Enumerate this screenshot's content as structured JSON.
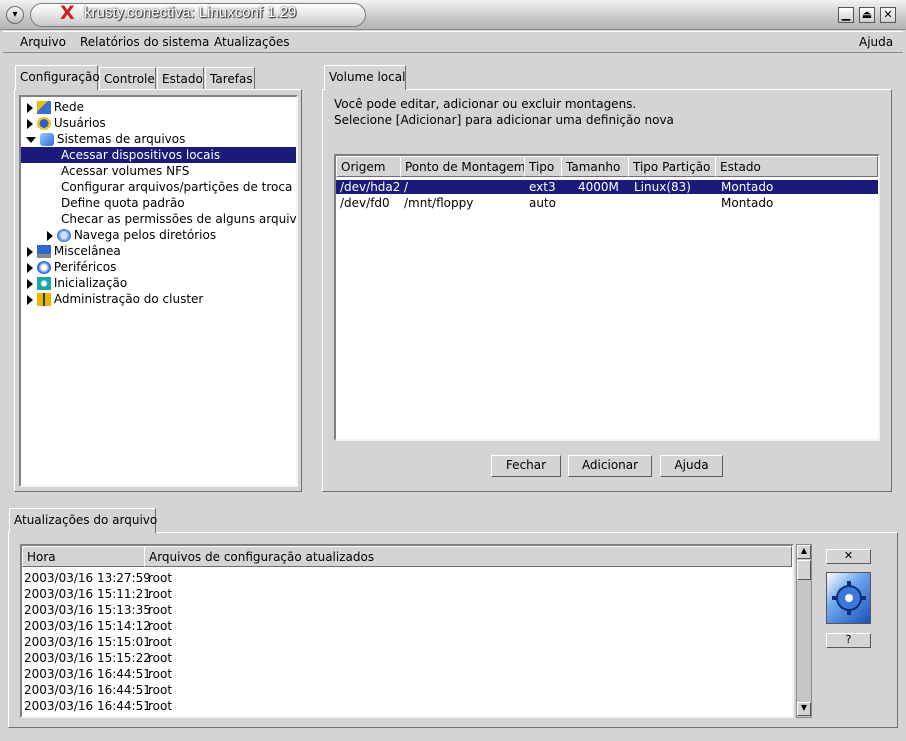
{
  "window": {
    "title": "krusty.conectiva: Linuxconf 1.29",
    "minimize_glyph": "▁",
    "maximize_glyph": "⏏",
    "close_glyph": "✕",
    "menu_glyph": "▾"
  },
  "menubar": {
    "items": [
      "Arquivo",
      "Relatórios do sistema",
      "Atualizações"
    ],
    "help": "Ajuda"
  },
  "left_tabs": [
    "Configuração",
    "Controle",
    "Estado",
    "Tarefas"
  ],
  "tree": [
    {
      "label": "Rede",
      "icon": "network-icon",
      "expander": "collapsed"
    },
    {
      "label": "Usuários",
      "icon": "users-icon",
      "expander": "collapsed"
    },
    {
      "label": "Sistemas de arquivos",
      "icon": "filesystem-icon",
      "expander": "expanded"
    },
    {
      "label": "Acessar dispositivos locais",
      "selected": true
    },
    {
      "label": "Acessar volumes NFS"
    },
    {
      "label": "Configurar arquivos/partições de troca (sv"
    },
    {
      "label": "Define quota padrão"
    },
    {
      "label": "Checar as permissões de alguns arquivos"
    },
    {
      "label": "Navega pelos diretórios",
      "icon": "directory-icon",
      "expander": "collapsed"
    },
    {
      "label": "Miscelânea",
      "icon": "misc-icon",
      "expander": "collapsed"
    },
    {
      "label": "Periféricos",
      "icon": "peripherals-icon",
      "expander": "collapsed"
    },
    {
      "label": "Inicialização",
      "icon": "boot-icon",
      "expander": "collapsed"
    },
    {
      "label": "Administração do cluster",
      "icon": "cluster-icon",
      "expander": "collapsed"
    }
  ],
  "volume": {
    "tab": "Volume local",
    "intro_line1": "Você pode editar, adicionar ou excluir montagens.",
    "intro_line2": "Selecione [Adicionar] para adicionar uma definição nova",
    "columns": [
      "Origem",
      "Ponto de Montagem",
      "Tipo",
      "Tamanho",
      "Tipo Partição",
      "Estado"
    ],
    "rows": [
      {
        "origem": "/dev/hda2",
        "ponto": "/",
        "tipo": "ext3",
        "tamanho": "4000M",
        "particao": "Linux(83)",
        "estado": "Montado",
        "selected": true
      },
      {
        "origem": "/dev/fd0",
        "ponto": "/mnt/floppy",
        "tipo": "auto",
        "tamanho": "",
        "particao": "",
        "estado": "Montado"
      }
    ],
    "buttons": {
      "close": "Fechar",
      "add": "Adicionar",
      "help": "Ajuda"
    }
  },
  "updates": {
    "tab": "Atualizações do arquivo",
    "columns": [
      "Hora",
      "Arquivos de configuração atualizados"
    ],
    "rows": [
      {
        "time": "2003/03/16 13:27:59",
        "files": "root"
      },
      {
        "time": "2003/03/16 15:11:21",
        "files": "root"
      },
      {
        "time": "2003/03/16 15:13:35",
        "files": "root"
      },
      {
        "time": "2003/03/16 15:14:12",
        "files": "root"
      },
      {
        "time": "2003/03/16 15:15:01",
        "files": "root"
      },
      {
        "time": "2003/03/16 15:15:22",
        "files": "root"
      },
      {
        "time": "2003/03/16 16:44:51",
        "files": "root"
      },
      {
        "time": "2003/03/16 16:44:51",
        "files": "root"
      },
      {
        "time": "2003/03/16 16:44:51",
        "files": "root"
      }
    ],
    "close_glyph": "✕",
    "help_glyph": "?"
  },
  "colors": {
    "selection": "#1a1a7a",
    "background": "#d4d4d4"
  }
}
